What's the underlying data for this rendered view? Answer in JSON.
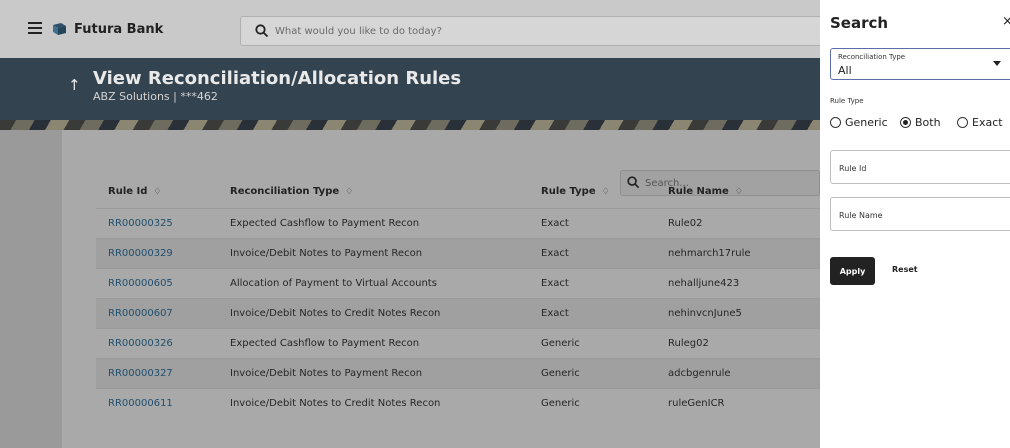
{
  "topbar": {
    "brand": "Futura Bank",
    "search_placeholder": "What would you like to do today?",
    "menu_icon": "hamburger-icon",
    "search_icon": "search-icon",
    "logo_icon": "bank-logo-icon"
  },
  "header": {
    "back_icon": "arrow-up-icon",
    "title": "View Reconciliation/Allocation Rules",
    "subtitle": "ABZ Solutions | ***462"
  },
  "table": {
    "search_placeholder": "Search...",
    "columns": [
      {
        "label": "Rule Id",
        "sort_icon": "♢"
      },
      {
        "label": "Reconciliation Type",
        "sort_icon": "♢"
      },
      {
        "label": "Rule Type",
        "sort_icon": "♢"
      },
      {
        "label": "Rule Name",
        "sort_icon": "♢"
      }
    ],
    "rows": [
      [
        "RR00000325",
        "Expected Cashflow to Payment Recon",
        "Exact",
        "Rule02"
      ],
      [
        "RR00000329",
        "Invoice/Debit Notes to Payment Recon",
        "Exact",
        "nehmarch17rule"
      ],
      [
        "RR00000605",
        "Allocation of Payment to Virtual Accounts",
        "Exact",
        "nehalljune423"
      ],
      [
        "RR00000607",
        "Invoice/Debit Notes to Credit Notes Recon",
        "Exact",
        "nehinvcnJune5"
      ],
      [
        "RR00000326",
        "Expected Cashflow to Payment Recon",
        "Generic",
        "Ruleg02"
      ],
      [
        "RR00000327",
        "Invoice/Debit Notes to Payment Recon",
        "Generic",
        "adcbgenrule"
      ],
      [
        "RR00000611",
        "Invoice/Debit Notes to Credit Notes Recon",
        "Generic",
        "ruleGenICR"
      ]
    ]
  },
  "panel": {
    "title": "Search",
    "close": "×",
    "reconciliation_type_label": "Reconciliation Type",
    "reconciliation_type_value": "All",
    "rule_type_label": "Rule Type",
    "rule_type_options": [
      "Generic",
      "Both",
      "Exact"
    ],
    "rule_type_selected": "Both",
    "rule_id_placeholder": "Rule Id",
    "rule_name_placeholder": "Rule Name",
    "apply_label": "Apply",
    "reset_label": "Reset"
  },
  "colors": {
    "link": "#1f4f6e",
    "banner": "#33434f",
    "select_border": "#5b6ea8"
  }
}
